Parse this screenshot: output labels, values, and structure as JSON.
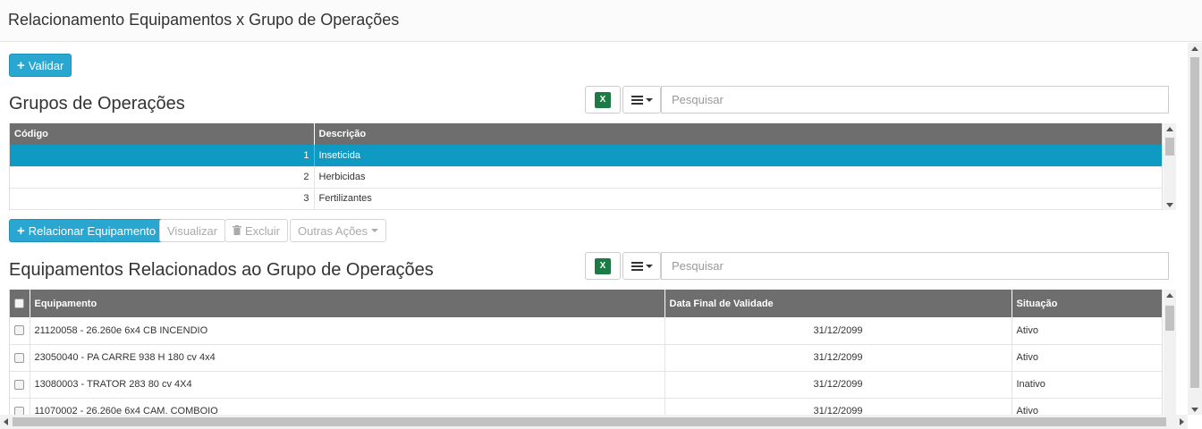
{
  "page": {
    "title": "Relacionamento Equipamentos x Grupo de Operações"
  },
  "toolbar": {
    "validar_label": "Validar"
  },
  "grupos": {
    "title": "Grupos de Operações",
    "excel_icon": "excel-icon",
    "search_placeholder": "Pesquisar",
    "columns": [
      "Código",
      "Descrição"
    ],
    "rows": [
      {
        "codigo": "1",
        "descricao": "Inseticida",
        "selected": true
      },
      {
        "codigo": "2",
        "descricao": "Herbicidas",
        "selected": false
      },
      {
        "codigo": "3",
        "descricao": "Fertilizantes",
        "selected": false
      }
    ]
  },
  "actions": {
    "relacionar": "Relacionar Equipamento",
    "visualizar": "Visualizar",
    "excluir": "Excluir",
    "outras": "Outras Ações"
  },
  "equipamentos": {
    "title": "Equipamentos Relacionados ao Grupo de Operações",
    "search_placeholder": "Pesquisar",
    "columns": [
      "Equipamento",
      "Data Final de Validade",
      "Situação"
    ],
    "rows": [
      {
        "equipamento": "21120058 - 26.260e 6x4 CB INCENDIO",
        "data": "31/12/2099",
        "situacao": "Ativo"
      },
      {
        "equipamento": "23050040 - PA CARRE 938 H 180 cv 4x4",
        "data": "31/12/2099",
        "situacao": "Ativo"
      },
      {
        "equipamento": "13080003 - TRATOR 283 80 cv 4X4",
        "data": "31/12/2099",
        "situacao": "Inativo"
      },
      {
        "equipamento": "11070002 - 26.260e 6x4 CAM. COMBOIO",
        "data": "31/12/2099",
        "situacao": "Ativo"
      }
    ]
  },
  "colors": {
    "primary": "#2aa7d1",
    "selected_row": "#0e9ac3",
    "table_header": "#6e6e6e"
  }
}
